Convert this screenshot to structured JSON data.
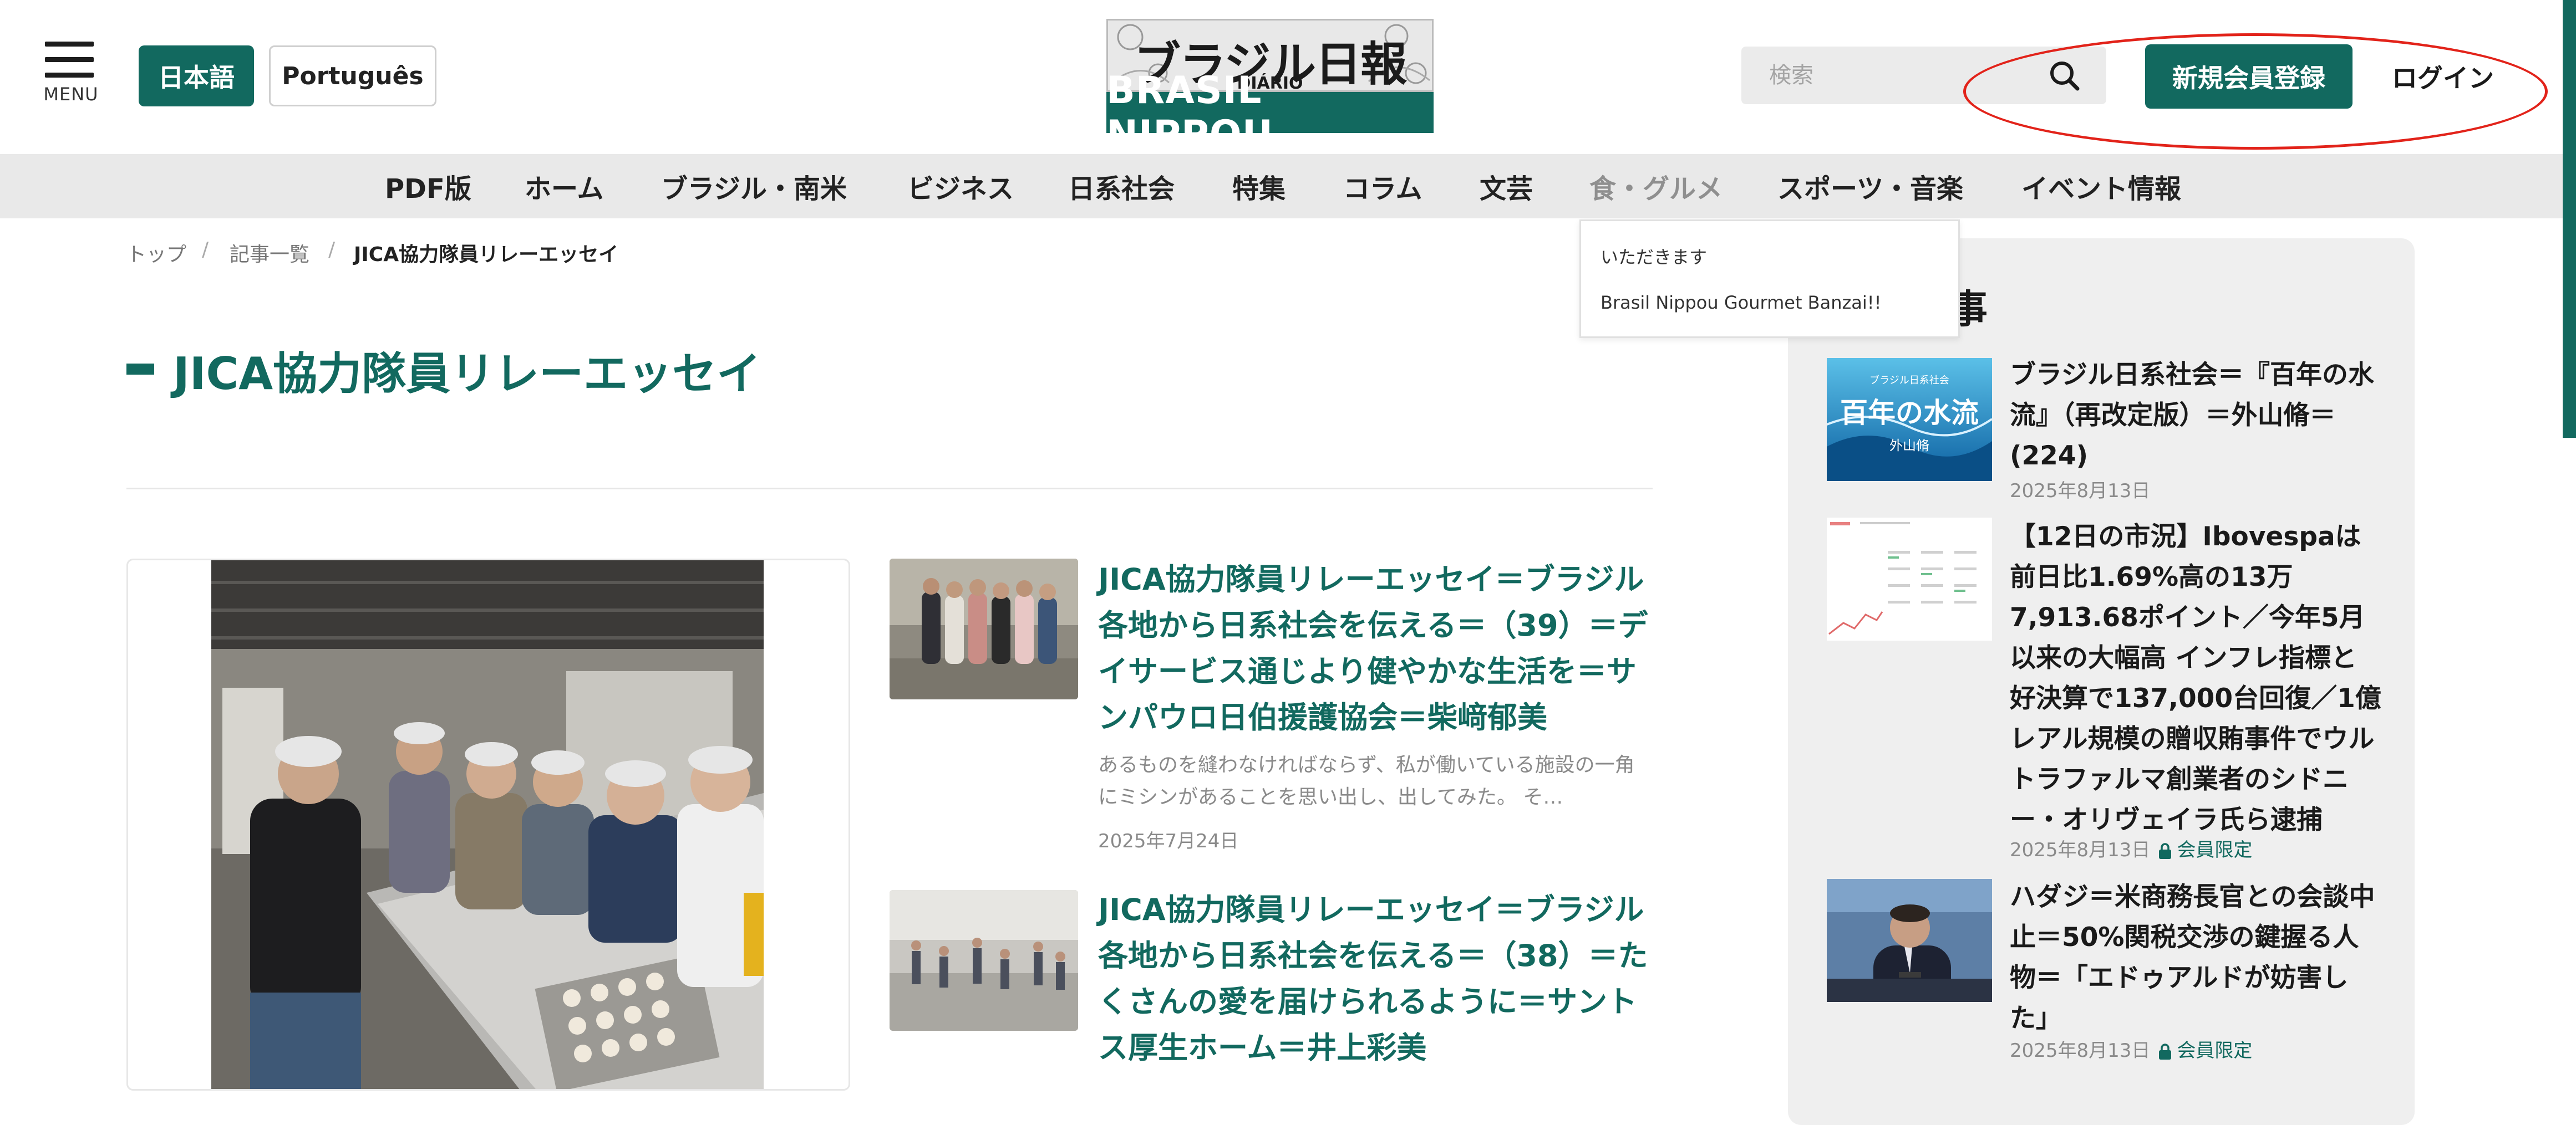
{
  "header": {
    "menu_label": "MENU",
    "lang_ja": "日本語",
    "lang_pt": "Português",
    "logo_top": "ブラジル日報",
    "logo_sub": "DIÁRIO",
    "logo_bottom": "BRASIL NIPPOU",
    "search_placeholder": "検索",
    "signup_label": "新規会員登録",
    "login_label": "ログイン"
  },
  "nav": {
    "items": [
      "PDF版",
      "ホーム",
      "ブラジル・南米",
      "ビジネス",
      "日系社会",
      "特集",
      "コラム",
      "文芸",
      "食・グルメ",
      "スポーツ・音楽",
      "イベント情報"
    ],
    "active_index": 8,
    "dropdown": [
      "いただきます",
      "Brasil Nippou Gourmet Banzai!!"
    ]
  },
  "breadcrumb": {
    "top": "トップ",
    "list": "記事一覧",
    "current": "JICA協力隊員リレーエッセイ",
    "separator": "/"
  },
  "page_title": "JICA協力隊員リレーエッセイ",
  "articles": [
    {
      "title": "JICA協力隊員リレーエッセイ＝ブラジル各地から日系社会を伝える＝（39）＝デイサービス通じより健やかな生活を＝サンパウロ日伯援護協会＝柴﨑郁美",
      "excerpt": "あるものを縫わなければならず、私が働いている施設の一角にミシンがあることを思い出し、出してみた。 そ…",
      "date": "2025年7月24日"
    },
    {
      "title": "JICA協力隊員リレーエッセイ＝ブラジル各地から日系社会を伝える＝（38）＝たくさんの愛を届けられるように＝サントス厚生ホーム＝井上彩美"
    }
  ],
  "sidebar": {
    "heading_visible": "記事",
    "items": [
      {
        "thumb_caption_top": "ブラジル日系社会",
        "thumb_caption_main": "百年の水流",
        "thumb_caption_author": "外山脩",
        "title": "ブラジル日系社会＝『百年の水流』（再改定版）＝外山脩＝(224)",
        "date": "2025年8月13日"
      },
      {
        "title": "【12日の市況】Ibovespaは前日比1.69%高の13万7,913.68ポイント／今年5月以来の大幅高 インフレ指標と好決算で137,000台回復／1億レアル規模の贈収賄事件でウルトラファルマ創業者のシドニー・オリヴェイラ氏ら逮捕",
        "date": "2025年8月13日",
        "badge": "会員限定"
      },
      {
        "title": "ハダジ＝米商務長官との会談中止＝50%関税交渉の鍵握る人物＝「エドゥアルドが妨害した」",
        "date": "2025年8月13日",
        "badge": "会員限定"
      }
    ]
  },
  "colors": {
    "brand": "#12695f",
    "nav_bg": "#e9e9e9",
    "highlight": "#e2231a",
    "sidebar_bg": "#efefef"
  }
}
